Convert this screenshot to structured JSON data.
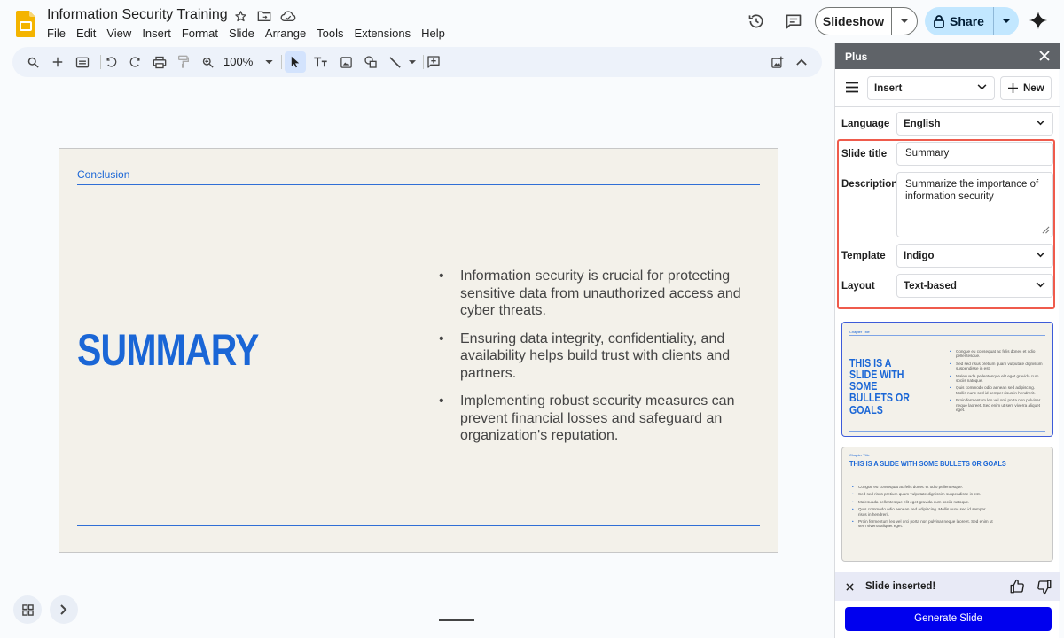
{
  "header": {
    "doc_title": "Information Security Training",
    "menu": [
      "File",
      "Edit",
      "View",
      "Insert",
      "Format",
      "Slide",
      "Arrange",
      "Tools",
      "Extensions",
      "Help"
    ],
    "slideshow_label": "Slideshow",
    "share_label": "Share"
  },
  "toolbar": {
    "zoom": "100%"
  },
  "slide": {
    "chapter": "Conclusion",
    "title": "SUMMARY",
    "bullets": [
      "Information security is crucial for protecting sensitive data from unauthorized access and cyber threats.",
      "Ensuring data integrity, confidentiality, and availability helps build trust with clients and partners.",
      "Implementing robust security measures can prevent financial losses and safeguard an organization's reputation."
    ]
  },
  "panel": {
    "title": "Plus",
    "mode_select": "Insert",
    "new_label": "New",
    "language_label": "Language",
    "language_value": "English",
    "slide_title_label": "Slide title",
    "slide_title_value": "Summary",
    "description_label": "Description",
    "description_value": "Summarize the importance of information security",
    "template_label": "Template",
    "template_value": "Indigo",
    "layout_label": "Layout",
    "layout_value": "Text-based",
    "notice": "Slide inserted!",
    "generate_label": "Generate Slide"
  },
  "thumbnails": [
    {
      "chapter": "Chapter Title",
      "title": "THIS IS A SLIDE WITH SOME BULLETS OR GOALS",
      "bullets": [
        "Congue eu consequat ac felis donec et odio pellentesque.",
        "Sed sed risus pretium quam vulputate dignissim suspendisse in est.",
        "Malesuada pellentesque elit eget gravida cum sociis natoque.",
        "Quis commodo odio aenean sed adipiscing. Mollis nunc sed id semper risus in hendrerit.",
        "Proin fermentum leo vel orci porta non pulvinar neque laoreet. Sed enim ut sem viverra aliquet eget."
      ]
    },
    {
      "chapter": "Chapter Title",
      "title": "THIS IS A SLIDE WITH SOME BULLETS OR GOALS",
      "bullets": [
        "Congue eu consequat ac felis donec et odio pellentesque.",
        "Sed sed risus pretium quam vulputate dignissim suspendisse in est.",
        "Malesuada pellentesque elit eget gravida cum sociis natoque.",
        "Quis commodo odio aenean sed adipiscing. Mollis nunc sed id semper risus in hendrerit.",
        "Proin fermentum leo vel orci porta non pulvinar neque laoreet. Sed enim ut sem viverra aliquet eget."
      ]
    }
  ],
  "colors": {
    "accent_blue": "#1a66d6",
    "highlight_red": "#ef5b4c",
    "generate_blue": "#0000ee",
    "share_bg": "#c2e7ff"
  },
  "icons": [
    "slides-logo-icon",
    "star-icon",
    "move-folder-icon",
    "cloud-saved-icon",
    "history-icon",
    "comment-icon",
    "gemini-icon"
  ]
}
